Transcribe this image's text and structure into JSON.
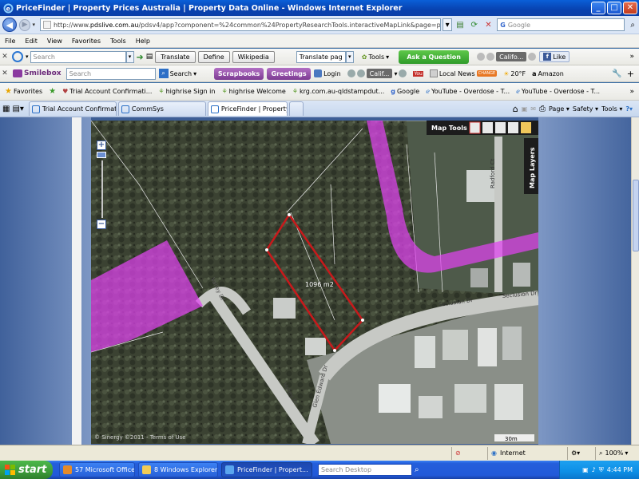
{
  "window": {
    "title": "PriceFinder | Property Prices Australia | Property Data Online - Windows Internet Explorer"
  },
  "address_bar": {
    "url_prefix": "http://www.",
    "url_domain": "pdslive.com.au",
    "url_rest": "/pdsv4/app?component=%24common%24PropertyResearchTools.interactiveMapLink&page=property%2FPropertyRe",
    "search_placeholder": "Google",
    "search_brand": "G"
  },
  "menu": {
    "items": [
      "File",
      "Edit",
      "View",
      "Favorites",
      "Tools",
      "Help"
    ]
  },
  "toolbar1": {
    "search_placeholder": "Search",
    "translate_label": "Translate",
    "define_label": "Define",
    "wikipedia_label": "Wikipedia",
    "translate_dropdown": "Translate pag",
    "tools_label": "Tools",
    "ask_label": "Ask a Question",
    "radio_text": "Califo...",
    "like_label": "Like"
  },
  "toolbar2": {
    "brand": "Smilebox",
    "search_placeholder": "Search",
    "search_label": "Search",
    "scrapbooks_label": "Scrapbooks",
    "greetings_label": "Greetings",
    "login_label": "Login",
    "radio_text": "Calif...",
    "local_news_label": "Local News",
    "local_news_badge": "CHANGE",
    "temp": "20°F",
    "amazon_label": "Amazon"
  },
  "favorites_bar": {
    "favorites_label": "Favorites",
    "items": [
      "Trial Account Confirmati...",
      "highrise Sign in",
      "highrise Welcome",
      "krg.com.au-qldstampdut...",
      "Google",
      "YouTube - Overdose - T...",
      "YouTube - Overdose - T..."
    ]
  },
  "tabs": {
    "items": [
      "Trial Account Confirmation | ...",
      "CommSys",
      "PriceFinder | Property Pri..."
    ],
    "page_label": "Page",
    "safety_label": "Safety",
    "tools_label": "Tools"
  },
  "map": {
    "tools_label": "Map Tools",
    "layers_label": "Map Layers",
    "area_label": "1096 m2",
    "street_seclusion_1": "Seclusion Dr",
    "street_seclusion_2": "Seclusion Dr",
    "street_radford": "Radford Ct",
    "street_left": "Valley Dr",
    "street_glen": "Glen Edward Dr",
    "street_bottom": "Valley Dr",
    "copyright": "© Sinergy ©2011 - Terms of Use",
    "scale": "30m",
    "colors": {
      "overlay": "#e043f0",
      "boundary": "#c8191b"
    }
  },
  "statusbar": {
    "zone": "Internet",
    "zoom": "100%"
  },
  "taskbar": {
    "start_label": "start",
    "items": [
      "57 Microsoft Office ...",
      "8 Windows Explorer",
      "PriceFinder | Propert..."
    ],
    "search_placeholder": "Search Desktop",
    "clock": "4:44 PM"
  }
}
